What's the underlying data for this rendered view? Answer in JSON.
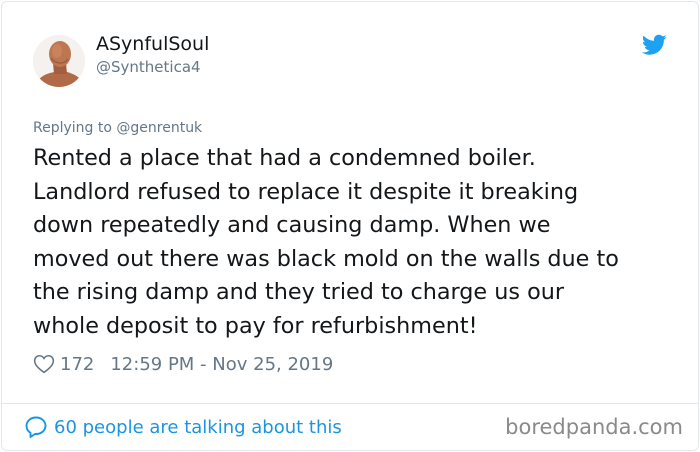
{
  "author": {
    "display_name": "ASynfulSoul",
    "handle": "@Synthetica4"
  },
  "reply": {
    "prefix": "Replying to",
    "mention": "@genrentuk"
  },
  "tweet": {
    "lines": [
      "Rented a place that had a condemned boiler.",
      "Landlord refused to replace it despite it breaking",
      "down repeatedly and causing damp. When we",
      "moved out there was black mold on the walls due to",
      "the rising damp and they tried to charge us our",
      "whole deposit to pay for refurbishment!"
    ]
  },
  "meta": {
    "likes": "172",
    "timestamp": "12:59 PM - Nov 25, 2019"
  },
  "footer": {
    "talking": "60 people are talking about this",
    "watermark": "boredpanda.com"
  },
  "colors": {
    "twitter_blue": "#1da1f2",
    "link_blue": "#1b95e0",
    "muted_gray": "#657786"
  },
  "icons": {
    "brand": "twitter-bird-icon",
    "like": "heart-icon",
    "conversation": "speech-bubble-icon"
  }
}
